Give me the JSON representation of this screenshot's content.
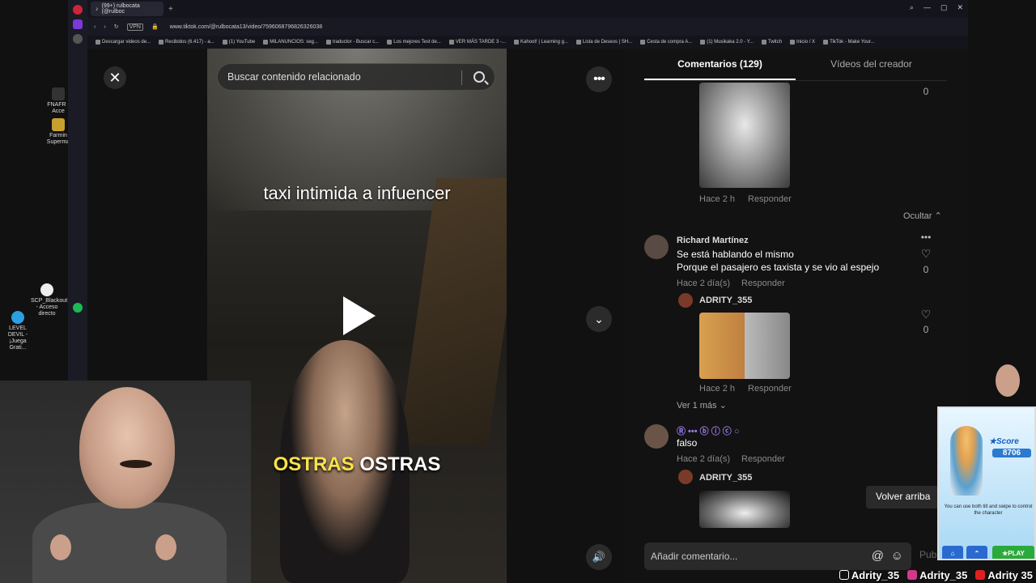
{
  "browser": {
    "tab_title": "(99+) rulbocata (@rulboc",
    "url": "www.tiktok.com/@rulbocata13/video/7596068796826326038",
    "bookmarks": [
      "Descargar videos de...",
      "Recibidos (6.417) - a...",
      "(1) YouTube",
      "MILANUNCIOS: seg...",
      "traductor - Buscar c...",
      "Los mejores Test de...",
      "VER MÁS TARDE 3 -...",
      "Kahoot! | Learning g...",
      "Lista de Deseos | SH...",
      "Cesta de compra A...",
      "(1) Musikaka 2.0 - Y...",
      "Twitch",
      "Inicio / X",
      "TikTok - Make Your..."
    ]
  },
  "video": {
    "search_placeholder": "Buscar contenido relacionado",
    "caption_top": "taxi intimida a infuencer",
    "caption_bottom_word1": "OSTRAS",
    "caption_bottom_word2": "OSTRAS"
  },
  "panel": {
    "tab_comments": "Comentarios (129)",
    "tab_creator": "Vídeos del creador",
    "top_like_count": "0",
    "reply1_time": "Hace 2 h",
    "reply1_action": "Responder",
    "hide_label": "Ocultar",
    "comment1": {
      "author": "Richard Martínez",
      "line1": "Se está hablando el mismo",
      "line2": "Porque el pasajero es taxista y se vio al espejo",
      "time": "Hace 2 día(s)",
      "action": "Responder",
      "likes": "0"
    },
    "reply2": {
      "author": "ADRITY_355",
      "time": "Hace 2 h",
      "action": "Responder",
      "likes": "0"
    },
    "see_more": "Ver 1 más",
    "comment2": {
      "text": "falso",
      "time": "Hace 2 día(s)",
      "action": "Responder"
    },
    "reply3_author": "ADRITY_355",
    "back_to_top": "Volver arriba",
    "add_comment_placeholder": "Añadir comentario...",
    "post_label": "Publicar"
  },
  "game_ad": {
    "score_label": "Score",
    "score_value": "8706",
    "hint": "You can use both tilt and swipe to control the character",
    "play_label": "PLAY"
  },
  "socials": {
    "tiktok": "Adrity_35",
    "instagram": "Adrity_35",
    "youtube": "Adrity 35"
  },
  "desktop_icons": [
    "FNAFR - Acce",
    "Farmin Superma",
    "SCP_Blackout - Acceso directo",
    "LEVEL DEVIL - ¡Juega Grati..."
  ]
}
